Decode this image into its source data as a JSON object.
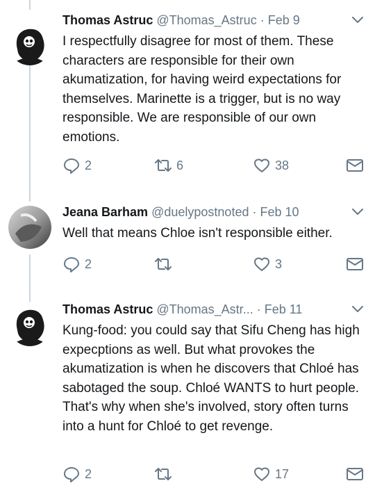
{
  "tweets": [
    {
      "name": "Thomas Astruc",
      "handle": "@Thomas_Astruc",
      "date": "Feb 9",
      "text": "I respectfully disagree for most of them. These characters are responsible for their own akumatization, for having weird expectations for themselves. Marinette is a trigger, but is no way responsible. We are responsible of our own emotions.",
      "replies": "2",
      "retweets": "6",
      "likes": "38"
    },
    {
      "name": "Jeana Barham",
      "handle": "@duelypostnoted",
      "date": "Feb 10",
      "text": "Well that means Chloe isn't responsible either.",
      "replies": "2",
      "retweets": "",
      "likes": "3"
    },
    {
      "name": "Thomas Astruc",
      "handle": "@Thomas_Astr...",
      "date": "Feb 11",
      "text": "Kung-food: you could say that Sifu Cheng has high expecptions as well. But what provokes the akumatization is when he discovers that Chloé has sabotaged the soup. Chloé WANTS to hurt people. That's why when she's involved, story often turns into a hunt for Chloé to get revenge.",
      "replies": "2",
      "retweets": "",
      "likes": "17"
    }
  ],
  "separator": "·",
  "icons": {
    "menu": "chevron-down-icon",
    "reply": "reply-icon",
    "retweet": "retweet-icon",
    "like": "heart-icon",
    "dm": "mail-icon"
  },
  "colors": {
    "text": "#14171a",
    "secondary": "#657786",
    "thread_line": "#ccd6dd"
  }
}
